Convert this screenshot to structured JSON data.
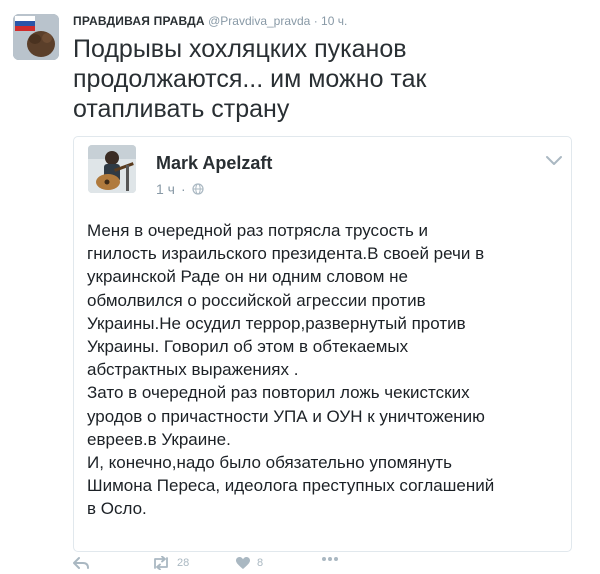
{
  "tweet": {
    "author_name": "ПРАВДИВАЯ ПРАВДА",
    "author_handle": "@Pravdiva_pravda",
    "separator": "·",
    "time": "10 ч.",
    "text": "Подрывы хохляцких пуканов\nпродолжаются... им можно так\nотапливать страну"
  },
  "quoted": {
    "author_name": "Mark Apelzaft",
    "time": "1 ч",
    "separator": "·",
    "text": "Меня в очередной раз потрясла трусость и\nгнилость израильского президента.В своей речи в\nукраинской Раде он ни одним словом не\nобмолвился о российской агрессии против\nУкраины.Не осудил террор,развернутый против\nУкраины. Говорил об этом в обтекаемых\nабстрактных выражениях .\nЗато в очередной раз повторил ложь чекистских\nуродов о причастности УПА и ОУН к уничтожению\nевреев.в Украине.\nИ, конечно,надо было обязательно упомянуть\nШимона Переса, идеолога преступных соглашений\nв Осло."
  },
  "actions": {
    "retweet_count": "28",
    "like_count": "8"
  },
  "icons": {
    "avatar": "flag-avatar",
    "quoted_avatar": "guitarist-photo",
    "privacy": "globe-icon",
    "menu": "chevron-down-icon",
    "reply": "reply-icon",
    "retweet": "retweet-icon",
    "like": "heart-icon",
    "more": "more-icon"
  }
}
